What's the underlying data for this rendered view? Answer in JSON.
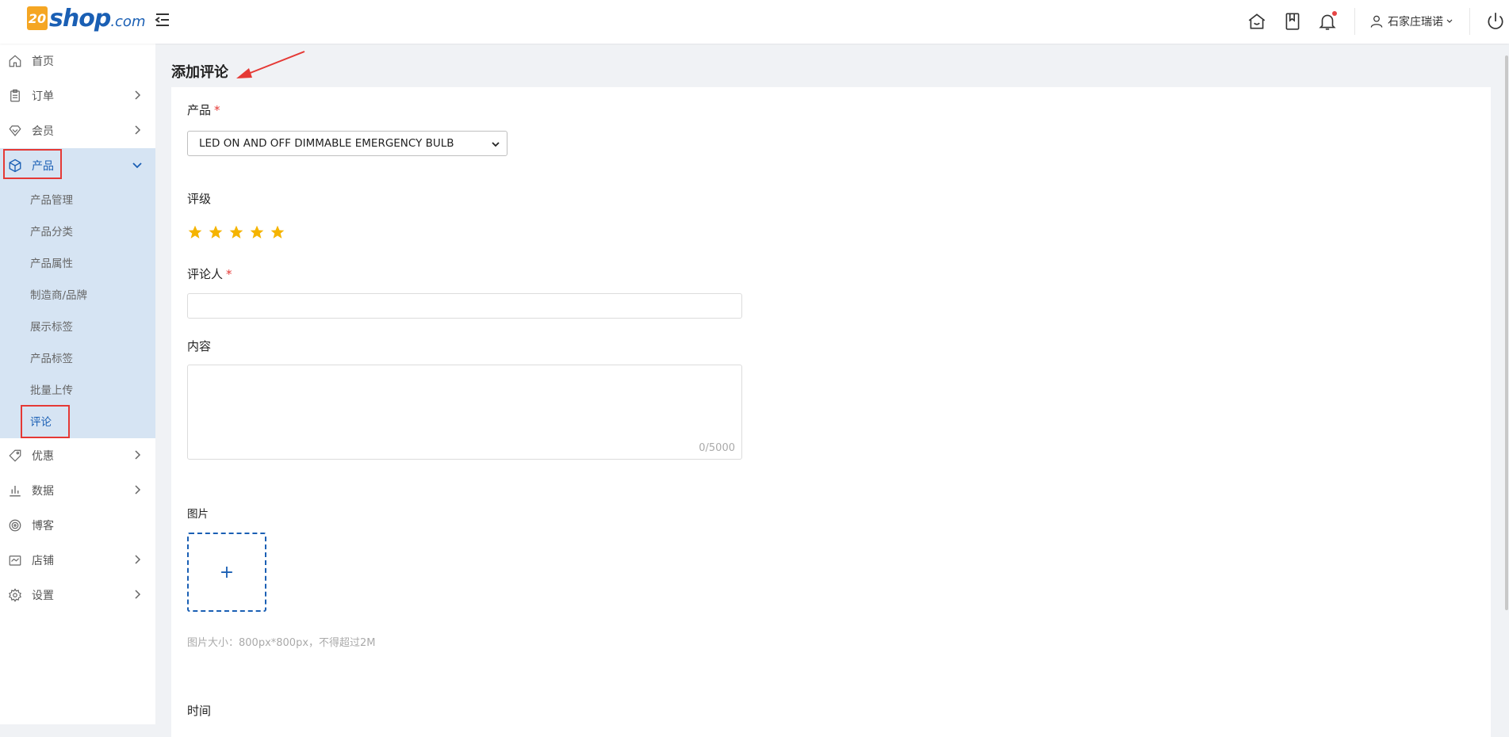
{
  "brand": {
    "badge": "20",
    "name": "shop",
    "domain": ".com"
  },
  "header": {
    "user_name": "石家庄瑞诺",
    "icons": [
      "home-outline-icon",
      "bookmark-icon",
      "bell-icon",
      "user-icon",
      "power-icon"
    ]
  },
  "sidebar": {
    "items": [
      {
        "label": "首页",
        "icon": "home-icon"
      },
      {
        "label": "订单",
        "icon": "clipboard-icon"
      },
      {
        "label": "会员",
        "icon": "diamond-icon"
      },
      {
        "label": "产品",
        "icon": "box-icon"
      },
      {
        "label": "优惠",
        "icon": "tag-icon"
      },
      {
        "label": "数据",
        "icon": "bar-chart-icon"
      },
      {
        "label": "博客",
        "icon": "target-icon"
      },
      {
        "label": "店铺",
        "icon": "store-icon"
      },
      {
        "label": "设置",
        "icon": "gear-icon"
      }
    ],
    "product_sub": [
      "产品管理",
      "产品分类",
      "产品属性",
      "制造商/品牌",
      "展示标签",
      "产品标签",
      "批量上传",
      "评论"
    ]
  },
  "page": {
    "title": "添加评论"
  },
  "form": {
    "product_label": "产品",
    "product_value": "LED ON AND OFF DIMMABLE EMERGENCY BULB",
    "rating_label": "评级",
    "rating_value": 5,
    "reviewer_label": "评论人",
    "reviewer_value": "",
    "content_label": "内容",
    "content_value": "",
    "content_counter": "0/5000",
    "image_label": "图片",
    "upload_symbol": "+",
    "image_hint": "图片大小：800px*800px，不得超过2M",
    "time_label": "时间",
    "required_mark": "*"
  },
  "colors": {
    "accent": "#1a5fb4",
    "star": "#f5b400",
    "highlight_box": "#e53935",
    "active_bg": "#d6e4f3"
  }
}
